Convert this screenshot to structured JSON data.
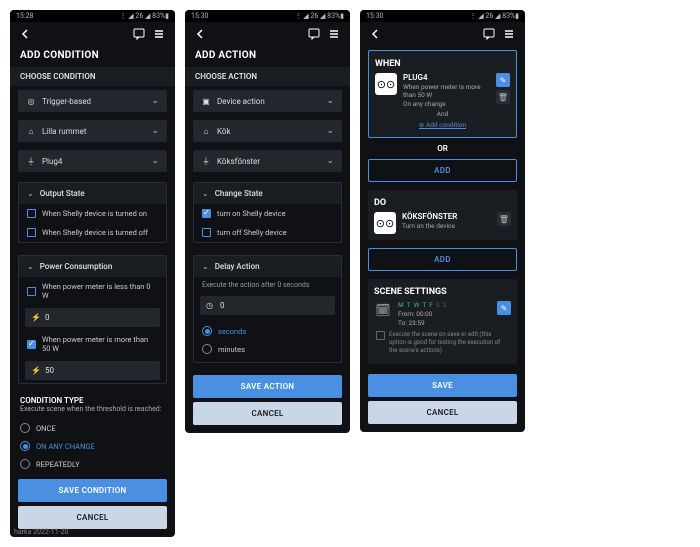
{
  "s1": {
    "status": {
      "time": "15:28",
      "left": "⌂ ⊞ ◎ •",
      "right": "⋮ ◢ 26 ◢ 83%▮"
    },
    "title": "ADD CONDITION",
    "choose_label": "CHOOSE CONDITION",
    "selects": [
      {
        "icon": "target",
        "label": "Trigger-based"
      },
      {
        "icon": "home",
        "label": "Lilla rummet"
      },
      {
        "icon": "plug",
        "label": "Plug4"
      }
    ],
    "output": {
      "head": "Output State",
      "rows": [
        {
          "label": "When Shelly device is turned on",
          "checked": false
        },
        {
          "label": "When Shelly device is turned off",
          "checked": false
        }
      ]
    },
    "power": {
      "head": "Power Consumption",
      "less": {
        "label": "When power meter is less than 0 W",
        "checked": false,
        "value": "0"
      },
      "more": {
        "label": "When power meter is more than 50 W",
        "checked": true,
        "value": "50"
      }
    },
    "cond_type": {
      "head": "CONDITION TYPE",
      "sub": "Execute scene when the threshold is reached:",
      "opts": [
        {
          "label": "ONCE",
          "sel": false
        },
        {
          "label": "ON ANY CHANGE",
          "sel": true
        },
        {
          "label": "REPEATEDLY",
          "sel": false
        }
      ]
    },
    "save": "SAVE CONDITION",
    "cancel": "CANCEL"
  },
  "s2": {
    "status": {
      "time": "15:30",
      "left": "⌂ ⊞ ◎ •",
      "right": "⋮ ◢ 26 ◢ 83%▮"
    },
    "title": "ADD ACTION",
    "choose_label": "CHOOSE ACTION",
    "selects": [
      {
        "icon": "cube",
        "label": "Device action"
      },
      {
        "icon": "home",
        "label": "Kök"
      },
      {
        "icon": "plug",
        "label": "Köksfönster"
      }
    ],
    "change": {
      "head": "Change State",
      "rows": [
        {
          "label": "turn on Shelly device",
          "checked": true
        },
        {
          "label": "turn off Shelly device",
          "checked": false
        }
      ]
    },
    "delay": {
      "head": "Delay Action",
      "sub": "Execute the action after 0 seconds",
      "value": "0",
      "units": [
        {
          "label": "seconds",
          "sel": true
        },
        {
          "label": "minutes",
          "sel": false
        }
      ]
    },
    "save": "SAVE ACTION",
    "cancel": "CANCEL"
  },
  "s3": {
    "status": {
      "time": "15:30",
      "left": "⌂ ⊞ ◎ •",
      "right": "⋮ ◢ 26 ◢ 83%▮"
    },
    "when": {
      "title": "WHEN",
      "dev": "PLUG4",
      "cond": "When power meter is more than 50 W",
      "mode": "On any change",
      "and": "And",
      "addcond": "Add condition",
      "or": "OR",
      "add": "ADD"
    },
    "do": {
      "title": "DO",
      "dev": "KÖKSFÖNSTER",
      "action": "Turn on the device",
      "add": "ADD"
    },
    "scene": {
      "title": "SCENE SETTINGS",
      "days": [
        "M",
        "T",
        "W",
        "T",
        "F",
        "S",
        "S"
      ],
      "from": "From: 00:00",
      "to": "To: 23:59",
      "exec": "Execute the scene on save or edit (this option is good for testing the execution of the scene's actions)"
    },
    "save": "SAVE",
    "cancel": "CANCEL"
  },
  "footer": "harka 2022-11-20"
}
